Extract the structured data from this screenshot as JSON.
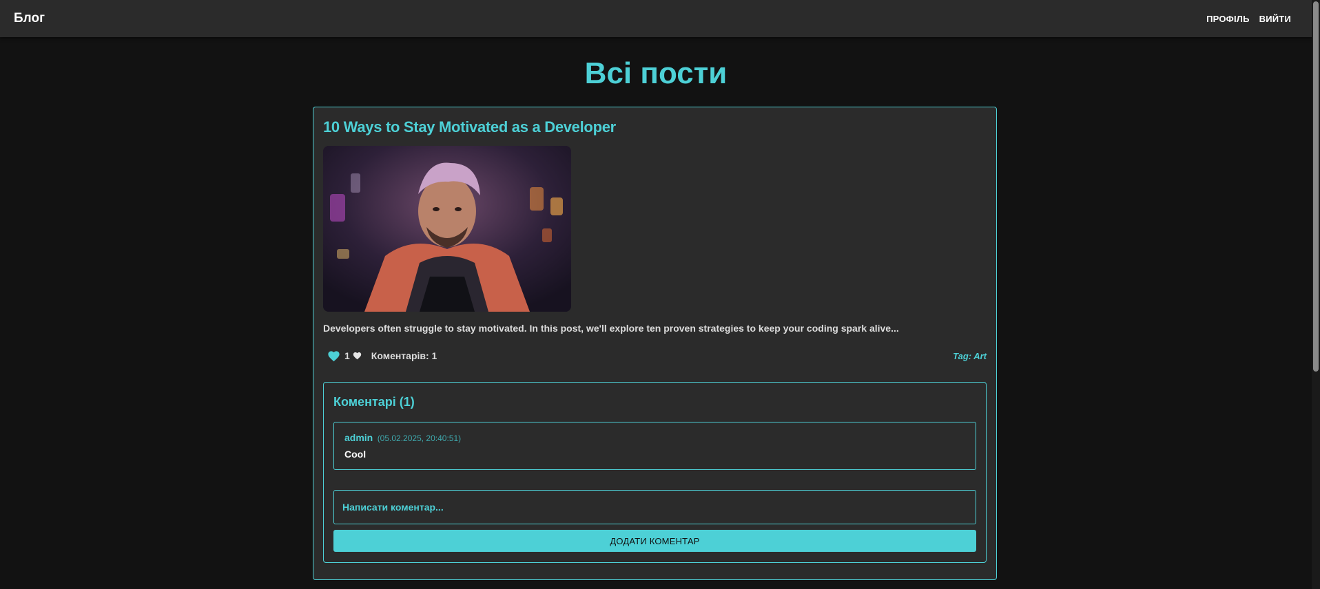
{
  "appbar": {
    "brand": "Блог",
    "nav": [
      {
        "label": "ПРОФІЛЬ"
      },
      {
        "label": "ВИЙТИ"
      }
    ]
  },
  "page": {
    "title": "Всі пости"
  },
  "post": {
    "title": "10 Ways to Stay Motivated as a Developer",
    "excerpt": "Developers often struggle to stay motivated. In this post, we'll explore ten proven strategies to keep your coding spark alive...",
    "likes": "1",
    "comments_count_label": "Коментарів: 1",
    "tag_label": "Tag: Art",
    "image_icon": "portrait-photo",
    "colors": {
      "accent": "#4dd0d6",
      "card_bg": "#2b2b2b",
      "page_bg": "#121212"
    }
  },
  "comments": {
    "heading": "Коментарі (1)",
    "items": [
      {
        "author": "admin",
        "date": "(05.02.2025, 20:40:51)",
        "text": "Cool"
      }
    ],
    "input_placeholder": "Написати коментар...",
    "submit_label": "ДОДАТИ КОМЕНТАР"
  }
}
